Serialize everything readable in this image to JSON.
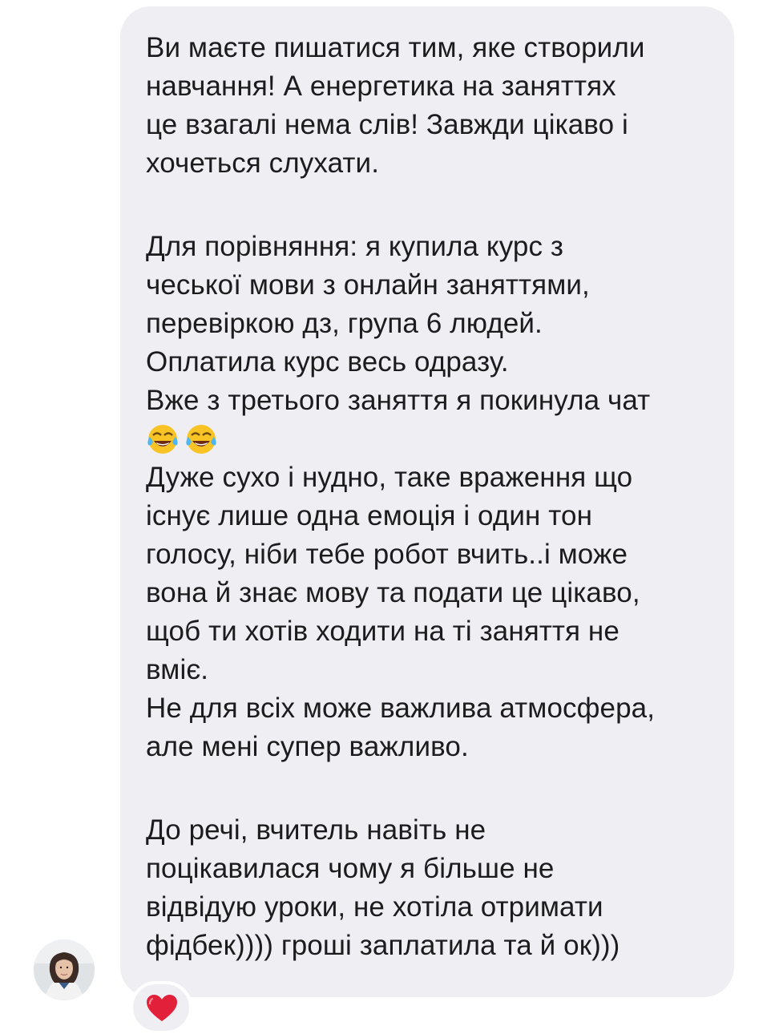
{
  "message": {
    "paragraph1": [
      "Ви маєте пишатися тим, яке створили",
      "навчання! А енергетика на заняттях",
      "це взагалі нема слів! Завжди цікаво і",
      "хочеться слухати."
    ],
    "paragraph2": [
      "Для порівняння: я купила курс з",
      "чеської мови з онлайн заняттями,",
      "перевіркою дз, група 6 людей.",
      "Оплатила курс весь одразу.",
      "Вже з третього заняття я покинула чат"
    ],
    "emojis": [
      "face-with-tears-of-joy-icon",
      "face-with-tears-of-joy-icon"
    ],
    "paragraph3": [
      "Дуже сухо і нудно, таке враження що",
      "існує лише одна емоція і один тон",
      "голосу, ніби тебе робот вчить..і може",
      "вона й знає мову та подати це цікаво,",
      "щоб ти хотів ходити на ті заняття не",
      "вміє.",
      "Не для всіх може важлива атмосфера,",
      "але мені супер важливо."
    ],
    "paragraph4": [
      "До речі, вчитель навіть не",
      "поцікавилася чому я більше не",
      "відвідую уроки, не хотіла отримати",
      "фідбек)))) гроші заплатила та й ок)))"
    ]
  },
  "sender": {
    "avatar_icon": "user-avatar-photo"
  },
  "reaction": {
    "icon": "red-heart-icon",
    "color": "#e3203a"
  },
  "colors": {
    "bubble_background": "#efeff3",
    "text": "#1c1c1e",
    "page_background": "#ffffff"
  }
}
